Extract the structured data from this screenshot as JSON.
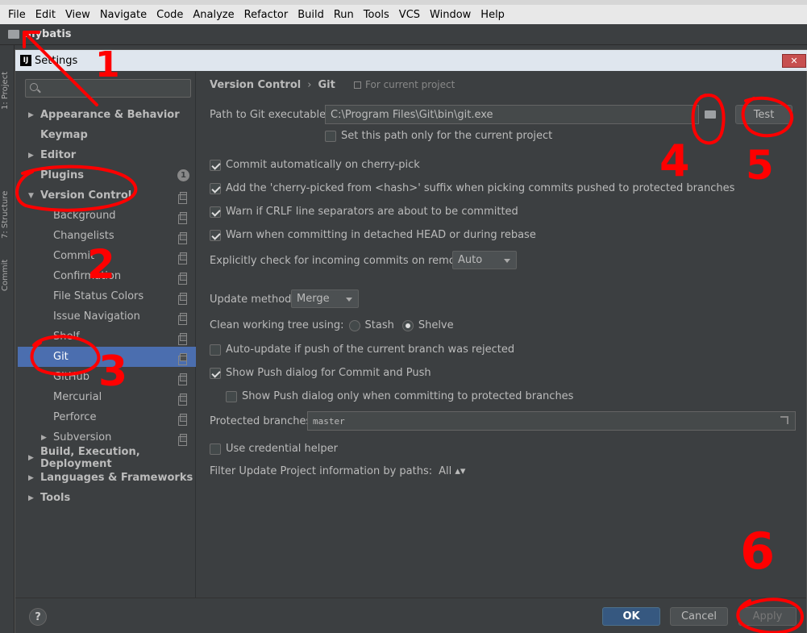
{
  "menubar": {
    "items": [
      {
        "label": "File",
        "u": "F",
        "rest": "ile"
      },
      {
        "label": "Edit",
        "u": "E",
        "rest": "dit"
      },
      {
        "label": "View",
        "u": "V",
        "rest": "iew"
      },
      {
        "label": "Navigate",
        "u": "N",
        "rest": "avigate"
      },
      {
        "label": "Code",
        "u": "C",
        "rest": "ode"
      },
      {
        "label": "Analyze",
        "u": "",
        "rest": "Analyze"
      },
      {
        "label": "Refactor",
        "u": "R",
        "rest": "efactor"
      },
      {
        "label": "Build",
        "u": "B",
        "rest": "uild"
      },
      {
        "label": "Run",
        "u": "",
        "rest": "Run"
      },
      {
        "label": "Tools",
        "u": "T",
        "rest": "ools"
      },
      {
        "label": "VCS",
        "u": "",
        "rest": "VCS"
      },
      {
        "label": "Window",
        "u": "W",
        "rest": "indow"
      },
      {
        "label": "Help",
        "u": "H",
        "rest": "elp"
      }
    ]
  },
  "navbar": {
    "project": "mybatis"
  },
  "side_tabs": {
    "project": "1: Project",
    "structure": "7: Structure",
    "commit": "Commit"
  },
  "dialog": {
    "title": "Settings",
    "logo": "IJ",
    "close": "✕"
  },
  "sidebar": {
    "search_placeholder": "",
    "items": [
      {
        "label": "Appearance & Behavior",
        "level": 0,
        "arrow": "▶",
        "badge": ""
      },
      {
        "label": "Keymap",
        "level": 0,
        "arrow": "",
        "badge": ""
      },
      {
        "label": "Editor",
        "level": 0,
        "arrow": "▶",
        "badge": ""
      },
      {
        "label": "Plugins",
        "level": 0,
        "arrow": "",
        "badge": "1"
      },
      {
        "label": "Version Control",
        "level": 0,
        "arrow": "▼",
        "badge": ""
      },
      {
        "label": "Background",
        "level": 1,
        "arrow": "",
        "badge": ""
      },
      {
        "label": "Changelists",
        "level": 1,
        "arrow": "",
        "badge": ""
      },
      {
        "label": "Commit",
        "level": 1,
        "arrow": "",
        "badge": ""
      },
      {
        "label": "Confirmation",
        "level": 1,
        "arrow": "",
        "badge": ""
      },
      {
        "label": "File Status Colors",
        "level": 1,
        "arrow": "",
        "badge": ""
      },
      {
        "label": "Issue Navigation",
        "level": 1,
        "arrow": "",
        "badge": ""
      },
      {
        "label": "Shelf",
        "level": 1,
        "arrow": "",
        "badge": ""
      },
      {
        "label": "Git",
        "level": 1,
        "arrow": "",
        "badge": ""
      },
      {
        "label": "GitHub",
        "level": 1,
        "arrow": "",
        "badge": ""
      },
      {
        "label": "Mercurial",
        "level": 1,
        "arrow": "",
        "badge": ""
      },
      {
        "label": "Perforce",
        "level": 1,
        "arrow": "",
        "badge": ""
      },
      {
        "label": "Subversion",
        "level": 1,
        "arrow": "▶",
        "badge": ""
      },
      {
        "label": "Build, Execution, Deployment",
        "level": 0,
        "arrow": "▶",
        "badge": ""
      },
      {
        "label": "Languages & Frameworks",
        "level": 0,
        "arrow": "▶",
        "badge": ""
      },
      {
        "label": "Tools",
        "level": 0,
        "arrow": "▶",
        "badge": ""
      }
    ],
    "selected": "Git"
  },
  "content": {
    "breadcrumb": {
      "parent": "Version Control",
      "sep": "›",
      "current": "Git"
    },
    "scope": "For current project",
    "git_path": {
      "label": "Path to Git executable:",
      "value": "C:\\Program Files\\Git\\bin\\git.exe",
      "test_button": "Test",
      "current_project_only": {
        "label": "Set this path only for the current project",
        "checked": false
      }
    },
    "options": {
      "cherry_pick": {
        "label": "Commit automatically on cherry-pick",
        "checked": true
      },
      "cherry_suffix": {
        "label": "Add the 'cherry-picked from <hash>' suffix when picking commits pushed to protected branches",
        "checked": true
      },
      "crlf": {
        "label": "Warn if CRLF line separators are about to be committed",
        "checked": true
      },
      "detached": {
        "label": "Warn when committing in detached HEAD or during rebase",
        "checked": true
      }
    },
    "incoming": {
      "label": "Explicitly check for incoming commits on remotes:",
      "value": "Auto"
    },
    "update_method": {
      "label": "Update method:",
      "value": "Merge"
    },
    "clean_tree": {
      "label": "Clean working tree using:",
      "stash": "Stash",
      "shelve": "Shelve",
      "selected": "Shelve"
    },
    "auto_update": {
      "label": "Auto-update if push of the current branch was rejected",
      "checked": false
    },
    "push_dialog": {
      "label": "Show Push dialog for Commit and Push",
      "checked": true
    },
    "push_dialog_protected": {
      "label": "Show Push dialog only when committing to protected branches",
      "checked": false
    },
    "protected": {
      "label": "Protected branches:",
      "value": "master"
    },
    "credential": {
      "label": "Use credential helper",
      "checked": false
    },
    "filter": {
      "label": "Filter Update Project information by paths:",
      "value": "All ▴▾"
    }
  },
  "footer": {
    "help": "?",
    "ok": "OK",
    "cancel": "Cancel",
    "apply": "Apply"
  },
  "annotations": {
    "n1": "1",
    "n2": "2",
    "n3": "3",
    "n4": "4",
    "n5": "5",
    "n6": "6",
    "color": "#ff0000"
  }
}
